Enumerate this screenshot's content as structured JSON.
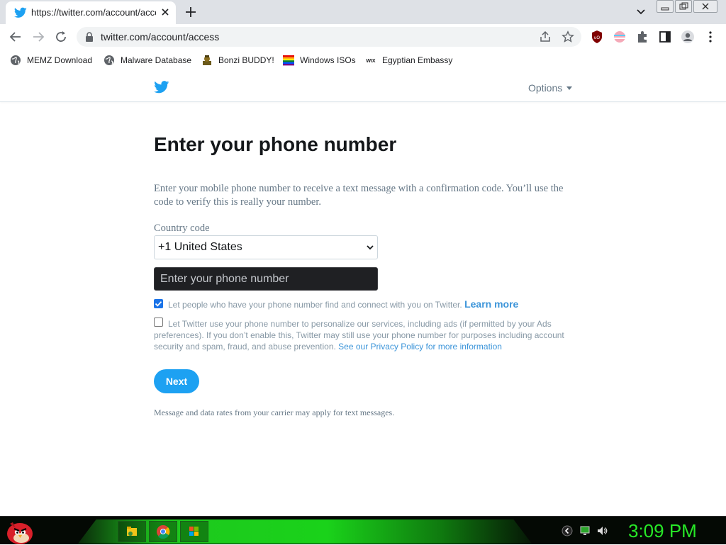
{
  "browser": {
    "tab_title": "https://twitter.com/account/acce",
    "url": "twitter.com/account/access",
    "bookmarks": [
      "MEMZ Download",
      "Malware Database",
      "Bonzi BUDDY!",
      "Windows ISOs",
      "Egyptian Embassy"
    ]
  },
  "page": {
    "options_label": "Options",
    "heading": "Enter your phone number",
    "description": "Enter your mobile phone number to receive a text message with a confirmation code. You’ll use the code to verify this is really your number.",
    "country_code_label": "Country code",
    "country_code_value": "+1 United States",
    "phone_placeholder": "Enter your phone number",
    "checkbox1": {
      "text": "Let people who have your phone number find and connect with you on Twitter.",
      "link": "Learn more",
      "checked": true
    },
    "checkbox2": {
      "text": "Let Twitter use your phone number to personalize our services, including ads (if permitted by your Ads preferences). If you don’t enable this, Twitter may still use your phone number for purposes including account security and spam, fraud, and abuse prevention.",
      "link": "See our Privacy Policy for more information",
      "checked": false
    },
    "next_label": "Next",
    "footnote": "Message and data rates from your carrier may apply for text messages."
  },
  "taskbar": {
    "clock": "3:09 PM"
  },
  "colors": {
    "twitter_blue": "#1da1f2",
    "link_blue": "#3b94d9",
    "clock_green": "#27e827"
  }
}
